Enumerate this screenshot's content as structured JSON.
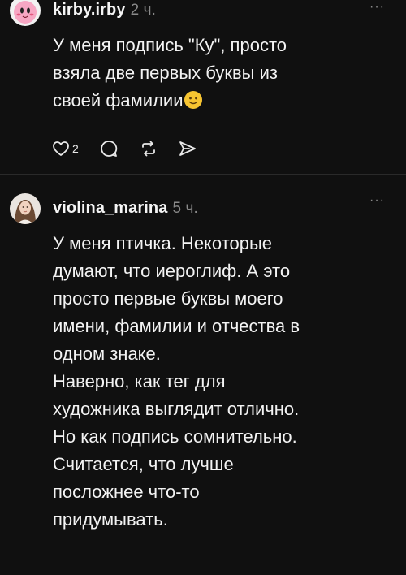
{
  "comments": [
    {
      "username": "kirby.irby",
      "time": "2 ч.",
      "text": "У меня подпись \"Ку\", просто\nвзяла две первых буквы из\nсвоей фамилии",
      "emoji": "slightly-smiling-face-icon",
      "likes": "2"
    },
    {
      "username": "violina_marina",
      "time": "5 ч.",
      "text": "У меня птичка. Некоторые\nдумают, что иероглиф. А это\nпросто первые буквы моего\nимени, фамилии и отчества в\nодном знаке.\nНаверно, как тег для\nхудожника выглядит отлично.\nНо как подпись сомнительно.\nСчитается, что лучше\nпосложнее что-то\nпридумывать."
    }
  ],
  "more_label": "···",
  "colors": {
    "background": "#101010",
    "text": "#f3f3f3",
    "muted": "#8a8a8a",
    "emoji": "#f6c431"
  }
}
